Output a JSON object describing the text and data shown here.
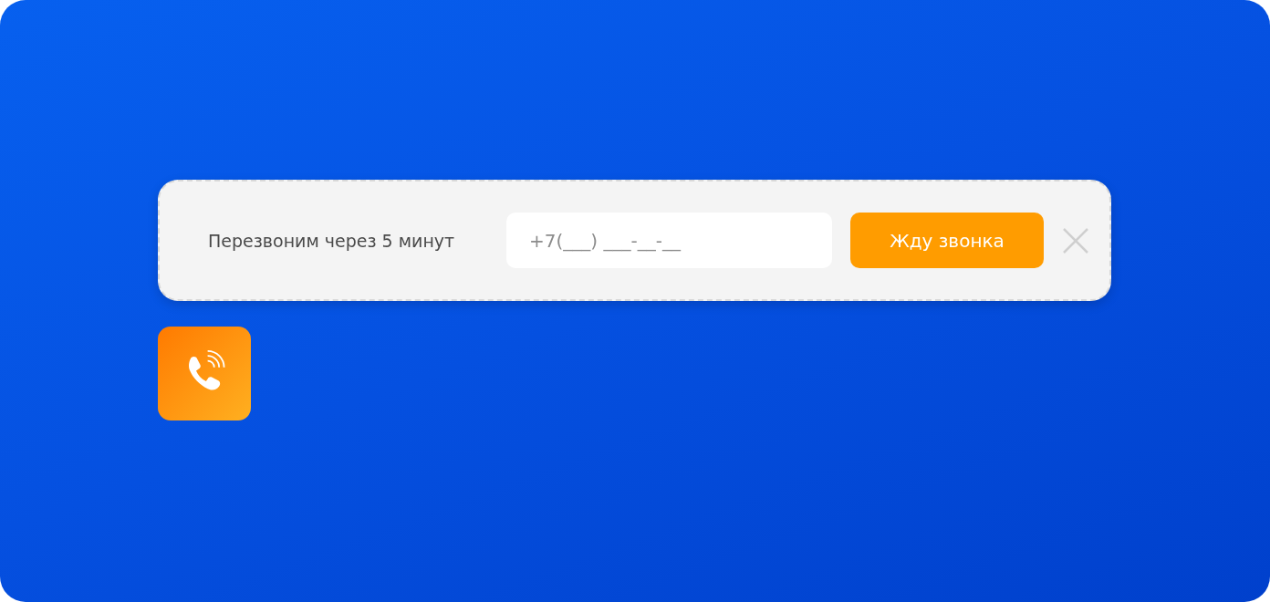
{
  "callback_bar": {
    "label": "Перезвоним через 5 минут",
    "phone_field": {
      "placeholder": "+7(___) ___-__-__"
    },
    "submit_button": "Жду звонка"
  }
}
